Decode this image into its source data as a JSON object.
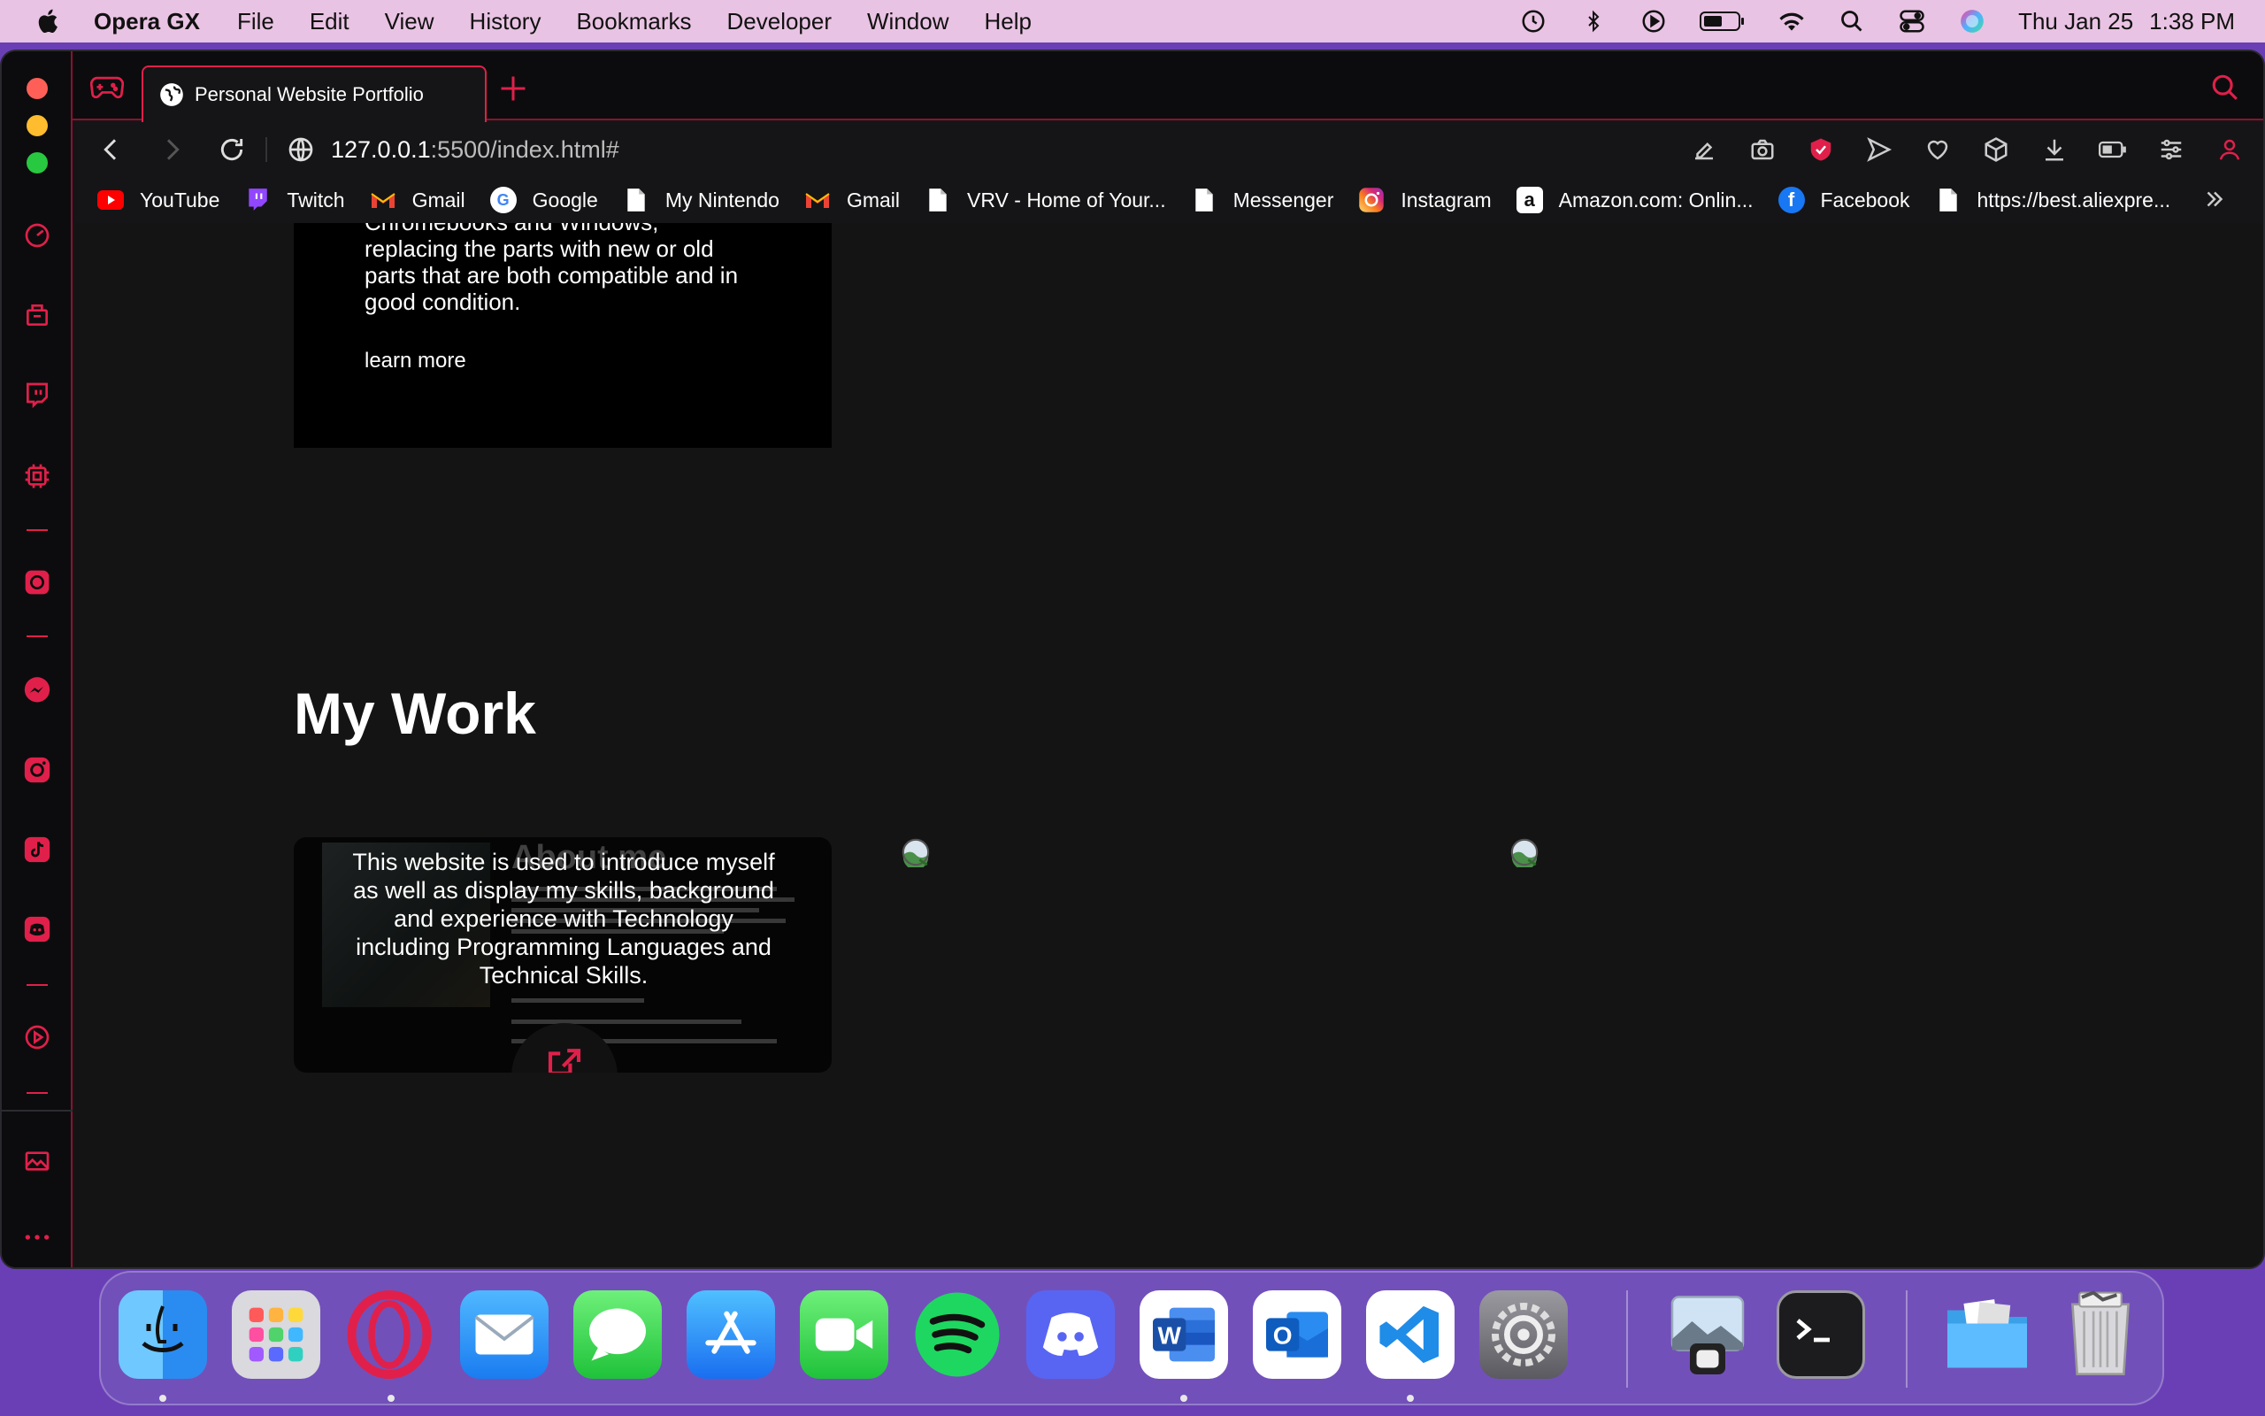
{
  "menubar": {
    "app_name": "Opera GX",
    "items": [
      "File",
      "Edit",
      "View",
      "History",
      "Bookmarks",
      "Developer",
      "Window",
      "Help"
    ],
    "date": "Thu Jan 25",
    "time": "1:38 PM"
  },
  "browser": {
    "tab_title": "Personal Website Portfolio",
    "url_host": "127.0.0.1",
    "url_path": ":5500/index.html#",
    "bookmarks": [
      {
        "label": "YouTube",
        "icon": "youtube-icon"
      },
      {
        "label": "Twitch",
        "icon": "twitch-icon"
      },
      {
        "label": "Gmail",
        "icon": "gmail-icon"
      },
      {
        "label": "Google",
        "icon": "google-icon"
      },
      {
        "label": "My Nintendo",
        "icon": "page-icon"
      },
      {
        "label": "Gmail",
        "icon": "gmail-icon"
      },
      {
        "label": "VRV - Home of Your...",
        "icon": "page-icon"
      },
      {
        "label": "Messenger",
        "icon": "page-icon"
      },
      {
        "label": "Instagram",
        "icon": "instagram-icon"
      },
      {
        "label": "Amazon.com: Onlin...",
        "icon": "amazon-icon"
      },
      {
        "label": "Facebook",
        "icon": "facebook-icon"
      },
      {
        "label": "https://best.aliexpre...",
        "icon": "page-icon"
      }
    ]
  },
  "page": {
    "service": {
      "clipped_line": "Chromebooks and Windows,",
      "description": "replacing the parts with new or old parts that are both compatible and in good condition.",
      "link": "learn more"
    },
    "section_title": "My Work",
    "work_card": {
      "thumb_title": "About me",
      "description": "This website is used to introduce myself as well as display my skills, background and experience with Technology including Programming Languages and Technical Skills."
    }
  },
  "colors": {
    "accent": "#e0204a",
    "page_bg": "#141414",
    "card_bg": "#000000",
    "menubar_bg": "#e9c3e3"
  },
  "dock": {
    "apps": [
      "Finder",
      "Launchpad",
      "Opera GX",
      "Mail",
      "Messages",
      "App Store",
      "FaceTime",
      "Spotify",
      "Discord",
      "Microsoft Word",
      "Microsoft Outlook",
      "Visual Studio Code",
      "System Settings",
      "Preview",
      "Terminal",
      "Downloads",
      "Trash"
    ]
  }
}
